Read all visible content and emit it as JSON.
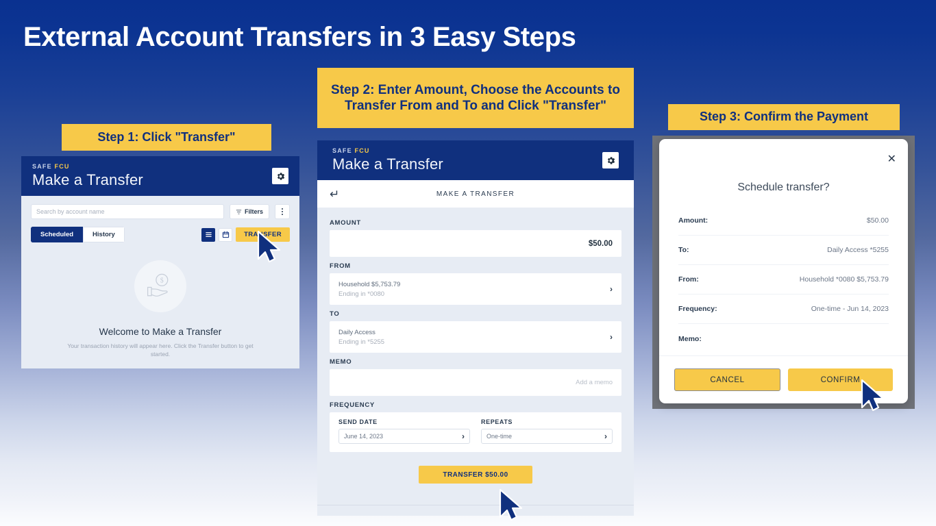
{
  "page": {
    "title": "External Account Transfers in 3 Easy Steps"
  },
  "colors": {
    "brand_navy": "#10307e",
    "brand_yellow": "#f7c949",
    "panel_bg": "#e7ecf4"
  },
  "banners": {
    "step1": "Step 1: Click \"Transfer\"",
    "step2": "Step 2: Enter Amount, Choose the Accounts to Transfer From and To and Click \"Transfer\"",
    "step3": "Step 3: Confirm the Payment"
  },
  "app": {
    "brand_safe": "SAFE",
    "brand_fcu": "FCU",
    "header_title": "Make a Transfer"
  },
  "panel1": {
    "search_placeholder": "Search by account name",
    "filters_label": "Filters",
    "tabs": [
      {
        "label": "Scheduled",
        "active": true
      },
      {
        "label": "History",
        "active": false
      }
    ],
    "transfer_button": "TRANSFER",
    "empty_title": "Welcome to Make a Transfer",
    "empty_subtitle": "Your transaction history will appear here. Click the Transfer button to get started."
  },
  "panel2": {
    "subbar_title": "MAKE A TRANSFER",
    "amount_label": "AMOUNT",
    "amount_value": "$50.00",
    "from_label": "FROM",
    "from_account": "Household  $5,753.79",
    "from_ending": "Ending in *0080",
    "to_label": "TO",
    "to_account": "Daily Access",
    "to_ending": "Ending in *5255",
    "memo_label": "MEMO",
    "memo_placeholder": "Add a memo",
    "frequency_label": "FREQUENCY",
    "send_date_label": "SEND DATE",
    "send_date_value": "June 14, 2023",
    "repeats_label": "REPEATS",
    "repeats_value": "One-time",
    "submit_button": "TRANSFER $50.00"
  },
  "panel3": {
    "modal_title": "Schedule transfer?",
    "rows": [
      {
        "label": "Amount:",
        "value": "$50.00"
      },
      {
        "label": "To:",
        "value": "Daily Access *5255"
      },
      {
        "label": "From:",
        "value": "Household *0080  $5,753.79"
      },
      {
        "label": "Frequency:",
        "value": "One-time - Jun 14, 2023"
      },
      {
        "label": "Memo:",
        "value": ""
      }
    ],
    "cancel_button": "CANCEL",
    "confirm_button": "CONFIRM"
  }
}
